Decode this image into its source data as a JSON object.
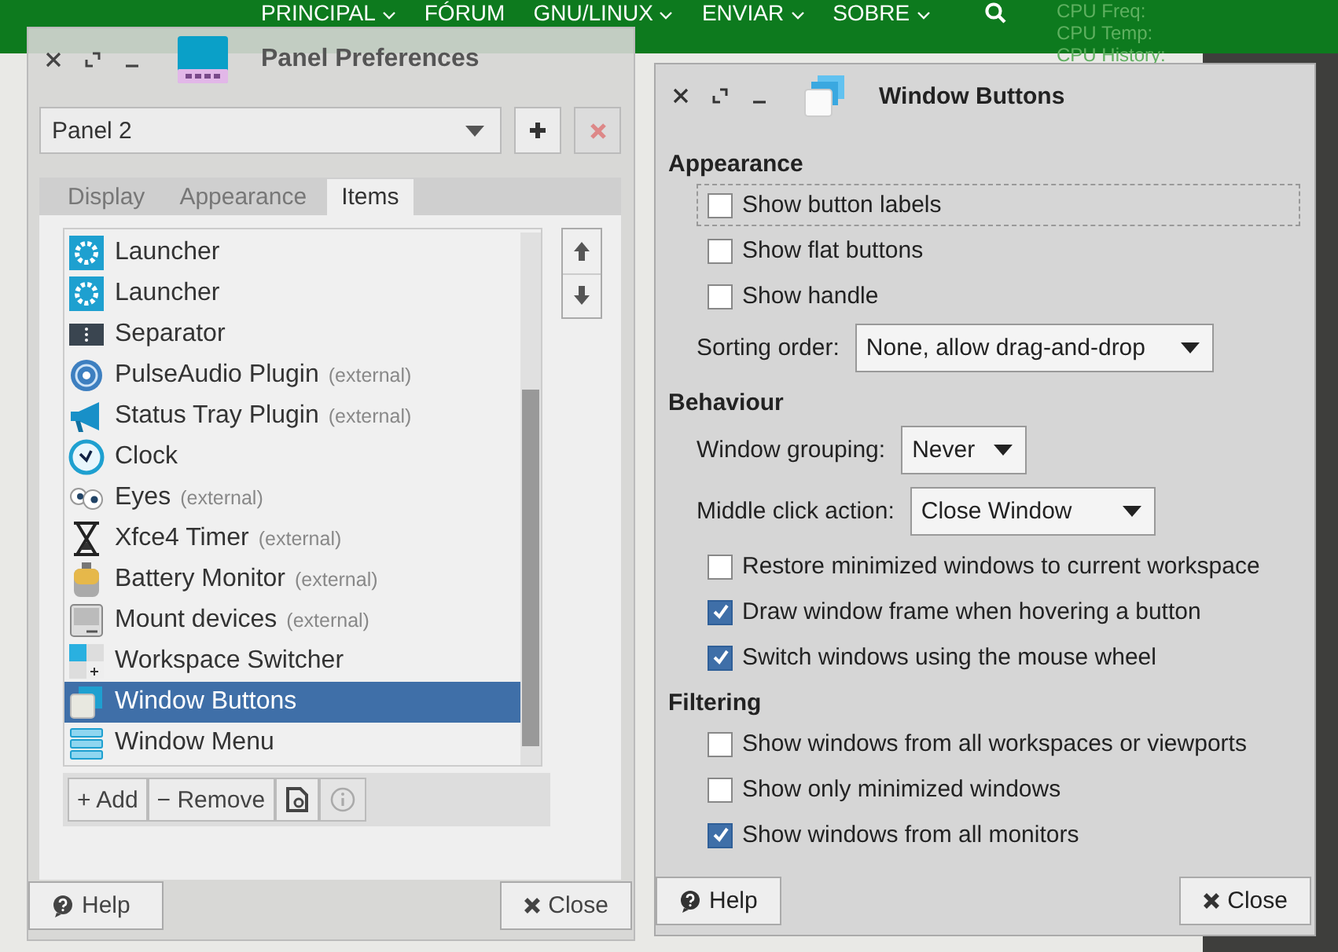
{
  "site_nav": {
    "items": [
      {
        "label": "PRINCIPAL",
        "dropdown": true
      },
      {
        "label": "FÓRUM",
        "dropdown": false
      },
      {
        "label": "GNU/LINUX",
        "dropdown": true
      },
      {
        "label": "ENVIAR",
        "dropdown": true
      },
      {
        "label": "SOBRE",
        "dropdown": true
      }
    ],
    "monitor_labels": [
      "CPU Freq:",
      "CPU Temp:",
      "CPU History:"
    ]
  },
  "panel_preferences": {
    "title": "Panel Preferences",
    "panel_select": {
      "value": "Panel 2"
    },
    "tabs": [
      {
        "label": "Display",
        "selected": false
      },
      {
        "label": "Appearance",
        "selected": false
      },
      {
        "label": "Items",
        "selected": true
      }
    ],
    "items": [
      {
        "name": "Launcher",
        "selected": false
      },
      {
        "name": "Launcher",
        "selected": false
      },
      {
        "name": "Separator",
        "selected": false
      },
      {
        "name": "PulseAudio Plugin",
        "note": "(external)",
        "selected": false
      },
      {
        "name": "Status Tray Plugin",
        "note": "(external)",
        "selected": false
      },
      {
        "name": "Clock",
        "selected": false
      },
      {
        "name": "Eyes",
        "note": "(external)",
        "selected": false
      },
      {
        "name": "Xfce4 Timer",
        "note": "(external)",
        "selected": false
      },
      {
        "name": "Battery Monitor",
        "note": "(external)",
        "selected": false
      },
      {
        "name": "Mount devices",
        "note": "(external)",
        "selected": false
      },
      {
        "name": "Workspace Switcher",
        "selected": false
      },
      {
        "name": "Window Buttons",
        "selected": true
      },
      {
        "name": "Window Menu",
        "selected": false
      }
    ],
    "toolbar": {
      "add": "+ Add",
      "remove": "− Remove"
    },
    "buttons": {
      "help": "Help",
      "close": "Close"
    }
  },
  "window_buttons": {
    "title": "Window Buttons",
    "sections": [
      {
        "heading": "Appearance",
        "rows": [
          {
            "kind": "checkbox",
            "label": "Show button labels",
            "checked": false,
            "focused": true
          },
          {
            "kind": "checkbox",
            "label": "Show flat buttons",
            "checked": false,
            "focused": false
          },
          {
            "kind": "checkbox",
            "label": "Show handle",
            "checked": false,
            "focused": false
          },
          {
            "kind": "select",
            "label": "Sorting order:",
            "value": "None, allow drag-and-drop"
          }
        ]
      },
      {
        "heading": "Behaviour",
        "rows": [
          {
            "kind": "select",
            "label": "Window grouping:",
            "value": "Never"
          },
          {
            "kind": "select",
            "label": "Middle click action:",
            "value": "Close Window"
          },
          {
            "kind": "checkbox",
            "label": "Restore minimized windows to current workspace",
            "checked": false,
            "focused": false
          },
          {
            "kind": "checkbox",
            "label": "Draw window frame when hovering a button",
            "checked": true,
            "focused": false
          },
          {
            "kind": "checkbox",
            "label": "Switch windows using the mouse wheel",
            "checked": true,
            "focused": false
          }
        ]
      },
      {
        "heading": "Filtering",
        "rows": [
          {
            "kind": "checkbox",
            "label": "Show windows from all workspaces or viewports",
            "checked": false,
            "focused": false
          },
          {
            "kind": "checkbox",
            "label": "Show only minimized windows",
            "checked": false,
            "focused": false
          },
          {
            "kind": "checkbox",
            "label": "Show windows from all monitors",
            "checked": true,
            "focused": false
          }
        ]
      }
    ],
    "buttons": {
      "help": "Help",
      "close": "Close"
    }
  }
}
